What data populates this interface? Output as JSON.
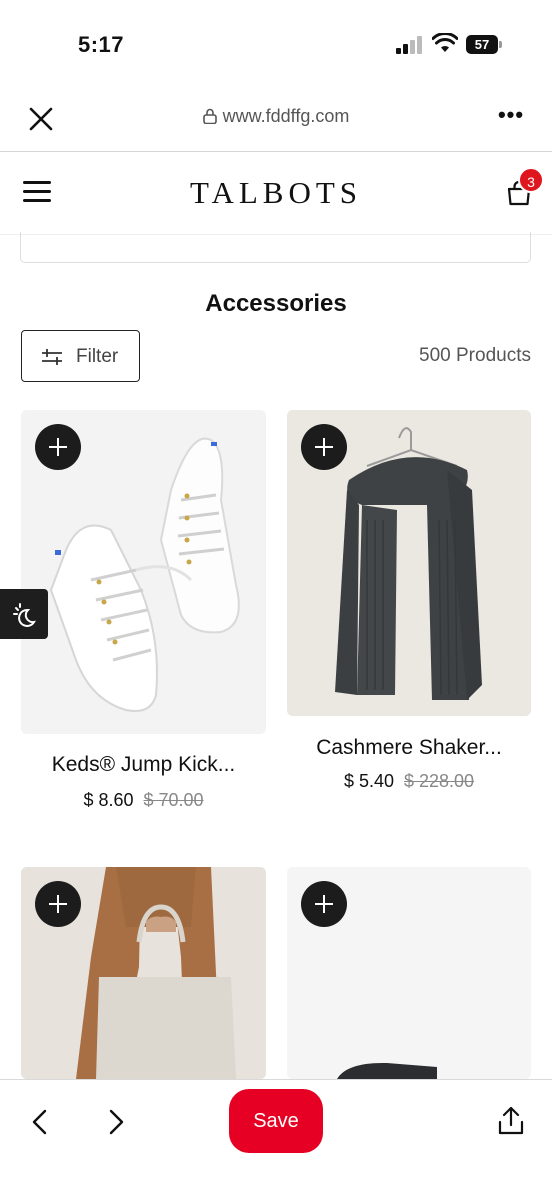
{
  "status_bar": {
    "time": "5:17",
    "battery_level": "57"
  },
  "browser": {
    "url": "www.fddffg.com",
    "more_label": "•••"
  },
  "header": {
    "logo": "TALBOTS",
    "cart_count": "3"
  },
  "page": {
    "title": "Accessories",
    "filter_label": "Filter",
    "product_count": "500 Products"
  },
  "products": [
    {
      "name": "Keds® Jump Kick...",
      "sale_price": "$ 8.60",
      "original_price": "$ 70.00"
    },
    {
      "name": "Cashmere Shaker...",
      "sale_price": "$ 5.40",
      "original_price": "$ 228.00"
    },
    {
      "name": "",
      "sale_price": "",
      "original_price": ""
    },
    {
      "name": "",
      "sale_price": "",
      "original_price": ""
    }
  ],
  "toolbar": {
    "save_label": "Save"
  },
  "colors": {
    "save_button": "#e60023",
    "cart_badge": "#e0161f",
    "dark": "#1c1c1c"
  }
}
